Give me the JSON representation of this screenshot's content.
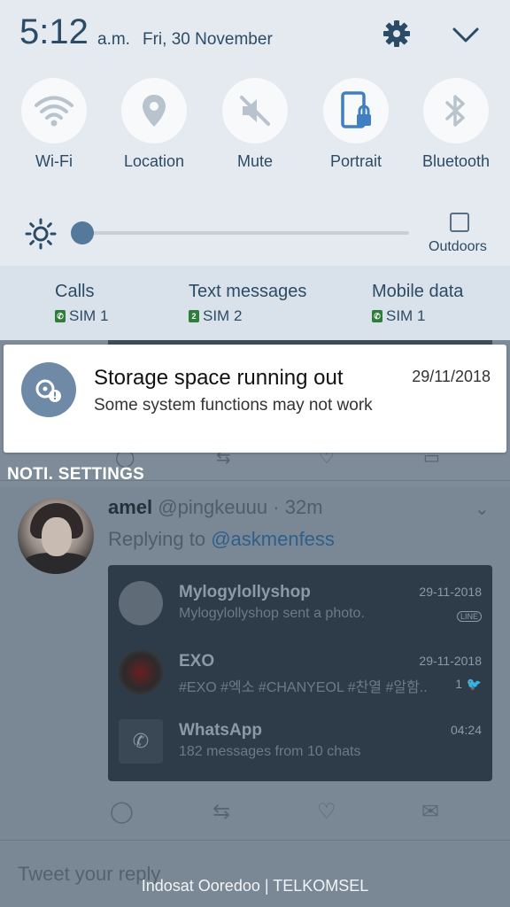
{
  "status": {
    "time": "5:12",
    "ampm": "a.m.",
    "date": "Fri, 30 November"
  },
  "quick_settings": {
    "tiles": [
      {
        "label": "Wi-Fi",
        "icon": "wifi-icon"
      },
      {
        "label": "Location",
        "icon": "location-pin-icon"
      },
      {
        "label": "Mute",
        "icon": "mute-icon"
      },
      {
        "label": "Portrait",
        "icon": "portrait-lock-icon"
      },
      {
        "label": "Bluetooth",
        "icon": "bluetooth-icon"
      }
    ],
    "brightness": {
      "level": 0.0
    },
    "outdoors_label": "Outdoors",
    "colors": {
      "panel": "#e4eaf0",
      "text": "#2c4b66",
      "accent": "#3f7fc3"
    }
  },
  "sim": {
    "calls": {
      "label": "Calls",
      "sim": "SIM 1",
      "badge": ""
    },
    "text": {
      "label": "Text messages",
      "sim": "SIM 2",
      "badge": "2"
    },
    "data": {
      "label": "Mobile data",
      "sim": "SIM 1",
      "badge": ""
    }
  },
  "notification": {
    "title": "Storage space running out",
    "date": "29/11/2018",
    "body": "Some system functions may not work",
    "icon": "storage-warning-icon"
  },
  "noti_settings": "NOTI. SETTINGS",
  "background": {
    "tweet": {
      "name": "amel",
      "handle": "@pingkeuuu",
      "time": "· 32m",
      "replying_prefix": "Replying to",
      "replying_to": "@askmenfess"
    },
    "card_rows": [
      {
        "title": "Mylogylollyshop",
        "text": "Mylogylollyshop sent a photo.",
        "date": "29-11-2018",
        "extra": "LINE"
      },
      {
        "title": "EXO",
        "text": "#EXO #엑소 #CHANYEOL #찬열 #알함..",
        "date": "29-11-2018",
        "extra": "1"
      },
      {
        "title": "WhatsApp",
        "text": "182 messages from 10 chats",
        "date": "04:24",
        "extra": ""
      }
    ],
    "reply_placeholder": "Tweet your reply"
  },
  "carrier": "Indosat Ooredoo | TELKOMSEL"
}
